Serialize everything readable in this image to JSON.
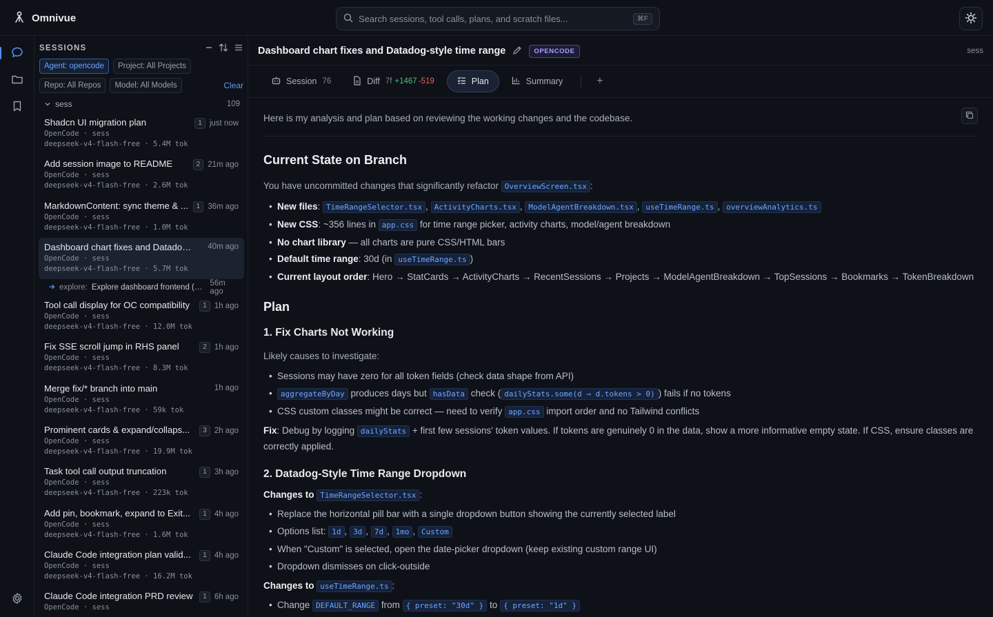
{
  "app": {
    "name": "Omnivue"
  },
  "search": {
    "placeholder": "Search sessions, tool calls, plans, and scratch files...",
    "shortcut": "⌘F"
  },
  "sidebar": {
    "title": "SESSIONS",
    "filters": {
      "agent": "Agent: opencode",
      "project": "Project: All Projects",
      "repo": "Repo: All Repos",
      "model": "Model: All Models",
      "clear": "Clear"
    },
    "group": {
      "name": "sess",
      "count": "109"
    },
    "sessions": [
      {
        "title": "Shadcn UI migration plan",
        "badge": "1",
        "time": "just now",
        "line1": "OpenCode · sess",
        "line2": "deepseek-v4-flash-free · 5.4M tok"
      },
      {
        "title": "Add session image to README",
        "badge": "2",
        "time": "21m ago",
        "line1": "OpenCode · sess",
        "line2": "deepseek-v4-flash-free · 2.6M tok"
      },
      {
        "title": "MarkdownContent: sync theme & ...",
        "badge": "1",
        "time": "36m ago",
        "line1": "OpenCode · sess",
        "line2": "deepseek-v4-flash-free · 1.0M tok"
      },
      {
        "title": "Dashboard chart fixes and Datadog-...",
        "badge": "",
        "time": "40m ago",
        "line1": "OpenCode · sess",
        "line2": "deepseek-v4-flash-free · 5.7M tok"
      },
      {
        "title": "Tool call display for OC compatibility",
        "badge": "1",
        "time": "1h ago",
        "line1": "OpenCode · sess",
        "line2": "deepseek-v4-flash-free · 12.0M tok"
      },
      {
        "title": "Fix SSE scroll jump in RHS panel",
        "badge": "2",
        "time": "1h ago",
        "line1": "OpenCode · sess",
        "line2": "deepseek-v4-flash-free · 8.3M tok"
      },
      {
        "title": "Merge fix/* branch into main",
        "badge": "",
        "time": "1h ago",
        "line1": "OpenCode · sess",
        "line2": "deepseek-v4-flash-free · 59k tok"
      },
      {
        "title": "Prominent cards & expand/collaps...",
        "badge": "3",
        "time": "2h ago",
        "line1": "OpenCode · sess",
        "line2": "deepseek-v4-flash-free · 19.9M tok"
      },
      {
        "title": "Task tool call output truncation",
        "badge": "1",
        "time": "3h ago",
        "line1": "OpenCode · sess",
        "line2": "deepseek-v4-flash-free · 223k tok"
      },
      {
        "title": "Add pin, bookmark, expand to Exit...",
        "badge": "1",
        "time": "4h ago",
        "line1": "OpenCode · sess",
        "line2": "deepseek-v4-flash-free · 1.6M tok"
      },
      {
        "title": "Claude Code integration plan valid...",
        "badge": "1",
        "time": "4h ago",
        "line1": "OpenCode · sess",
        "line2": "deepseek-v4-flash-free · 16.2M tok"
      },
      {
        "title": "Claude Code integration PRD review",
        "badge": "1",
        "time": "6h ago",
        "line1": "OpenCode · sess",
        "line2": ""
      }
    ],
    "subagent": {
      "label": "explore:",
      "text": "Explore dashboard frontend (@...",
      "time": "56m ago"
    }
  },
  "main": {
    "title": "Dashboard chart fixes and Datadog-style time range",
    "agent_badge": "OPENCODE",
    "right_label": "sess",
    "tabs": {
      "session": {
        "label": "Session",
        "count": "76"
      },
      "diff": {
        "label": "Diff",
        "files": "7f",
        "added": "+1467",
        "removed": "-519"
      },
      "plan": {
        "label": "Plan"
      },
      "summary": {
        "label": "Summary"
      },
      "add": "+"
    }
  },
  "plan": {
    "intro": "Here is my analysis and plan based on reviewing the working changes and the codebase.",
    "h_state": "Current State on Branch",
    "state_lead_a": "You have uncommitted changes that significantly refactor",
    "state_lead_code": "OverviewScreen.tsx",
    "state_lead_b": ":",
    "new_files_label": "New files",
    "new_files": [
      "TimeRangeSelector.tsx",
      "ActivityCharts.tsx",
      "ModelAgentBreakdown.tsx",
      "useTimeRange.ts",
      "overviewAnalytics.ts"
    ],
    "new_css_label": "New CSS",
    "new_css_a": ": ~356 lines in",
    "new_css_code": "app.css",
    "new_css_b": "for time range picker, activity charts, model/agent breakdown",
    "no_chart_label": "No chart library",
    "no_chart_text": "— all charts are pure CSS/HTML bars",
    "default_range_label": "Default time range",
    "default_range_a": ": 30d (in",
    "default_range_code": "useTimeRange.ts",
    "default_range_b": ")",
    "layout_label": "Current layout order",
    "layout_text": ": Hero → StatCards → ActivityCharts → RecentSessions → Projects → ModelAgentBreakdown → TopSessions → Bookmarks → TokenBreakdown",
    "h_plan": "Plan",
    "h_fix": "1. Fix Charts Not Working",
    "fix_lead": "Likely causes to investigate:",
    "cause1": "Sessions may have zero for all token fields (check data shape from API)",
    "cause2_code1": "aggregateByDay",
    "cause2_a": "produces days but",
    "cause2_code2": "hasData",
    "cause2_b": "check (",
    "cause2_code3": "dailyStats.some(d ⇒ d.tokens > 0)",
    "cause2_c": ") fails if no tokens",
    "cause3_a": "CSS custom classes might be correct — need to verify",
    "cause3_code": "app.css",
    "cause3_b": "import order and no Tailwind conflicts",
    "fix_label": "Fix",
    "fix_a": ": Debug by logging",
    "fix_code": "dailyStats",
    "fix_b": "+ first few sessions' token values. If tokens are genuinely 0 in the data, show a more informative empty state. If CSS, ensure classes are correctly applied.",
    "h_dropdown": "2. Datadog-Style Time Range Dropdown",
    "changes_label": "Changes to",
    "changes_code1": "TimeRangeSelector.tsx",
    "changes_colon": ":",
    "d1": "Replace the horizontal pill bar with a single dropdown button showing the currently selected label",
    "d2_label": "Options list:",
    "d2_opts": [
      "1d",
      "3d",
      "7d",
      "1mo",
      "Custom"
    ],
    "d3": "When \"Custom\" is selected, open the date-picker dropdown (keep existing custom range UI)",
    "d4": "Dropdown dismisses on click-outside",
    "changes_code2": "useTimeRange.ts",
    "e1_a": "Change",
    "e1_code1": "DEFAULT_RANGE",
    "e1_b": "from",
    "e1_code2": "{ preset: \"30d\" }",
    "e1_c": "to",
    "e1_code3": "{ preset: \"1d\" }"
  },
  "colors": {
    "accent": "#4f8ff7",
    "code": "#6ea6ff",
    "added": "#4ec27a",
    "removed": "#e5605c",
    "badge": "#a7a2ff"
  }
}
